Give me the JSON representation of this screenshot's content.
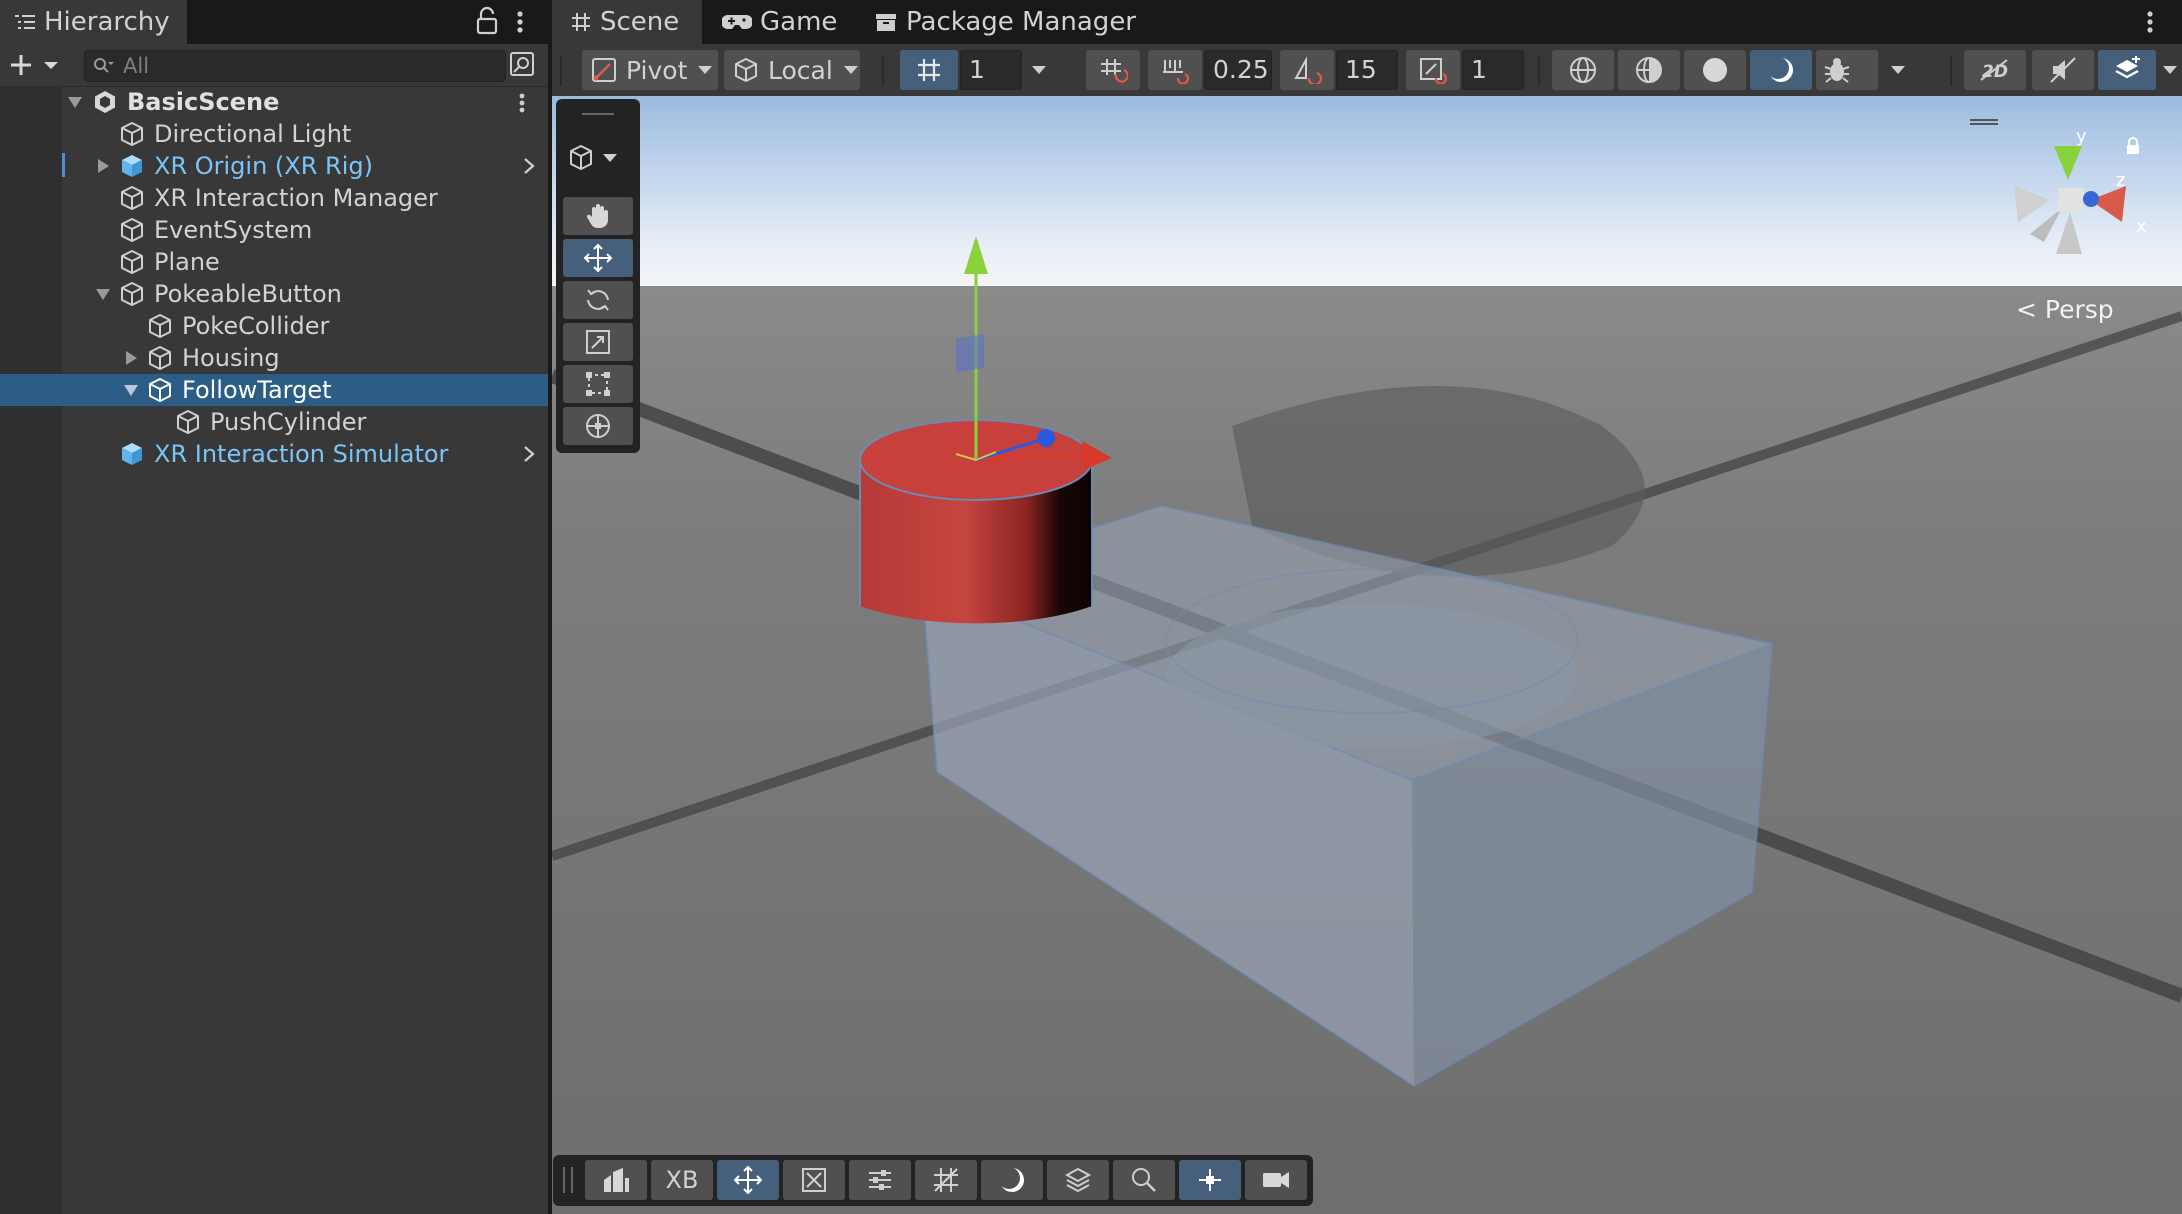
{
  "hierarchy": {
    "tab_label": "Hierarchy",
    "search_placeholder": "All",
    "scene_name": "BasicScene",
    "items": [
      {
        "label": "Directional Light"
      },
      {
        "label": "XR Origin (XR Rig)"
      },
      {
        "label": "XR Interaction Manager"
      },
      {
        "label": "EventSystem"
      },
      {
        "label": "Plane"
      },
      {
        "label": "PokeableButton"
      },
      {
        "label": "PokeCollider"
      },
      {
        "label": "Housing"
      },
      {
        "label": "FollowTarget"
      },
      {
        "label": "PushCylinder"
      },
      {
        "label": "XR Interaction Simulator"
      }
    ]
  },
  "tabs": {
    "scene": "Scene",
    "game": "Game",
    "package_manager": "Package Manager"
  },
  "scene_toolbar": {
    "pivot_label": "Pivot",
    "space_label": "Local",
    "grid_size": "1",
    "snap_increment": "0.25",
    "rotation_snap": "15",
    "scale_snap": "1"
  },
  "viewport": {
    "projection_label": "Persp",
    "gizmo_axes": {
      "x": "x",
      "y": "y",
      "z": "z"
    }
  },
  "overlay_toolbar": {
    "xb_label": "XB"
  },
  "colors": {
    "selection": "#2c5d87",
    "prefab_text": "#7cc4f6",
    "active_button": "#46607c",
    "panel": "#383838",
    "button_red": "#c43a36"
  }
}
